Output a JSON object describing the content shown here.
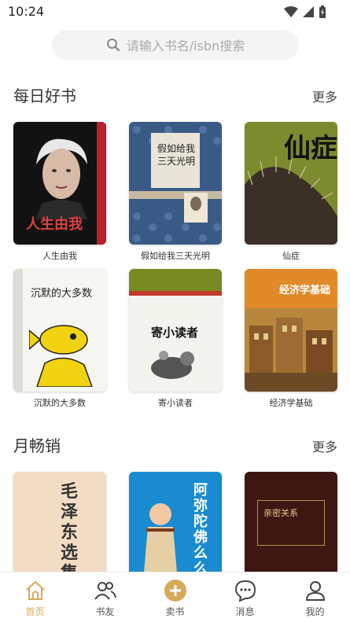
{
  "status": {
    "time": "10:24"
  },
  "search": {
    "placeholder": "请输入书名/isbn搜索"
  },
  "sections": [
    {
      "title": "每日好书",
      "more": "更多",
      "books": [
        {
          "title": "人生由我",
          "cover_text": "人生由我"
        },
        {
          "title": "假如给我三天光明",
          "cover_text": "假如给我三天光明"
        },
        {
          "title": "仙症",
          "cover_text": "仙症"
        },
        {
          "title": "沉默的大多数",
          "cover_text": "沉默的大多数"
        },
        {
          "title": "寄小读者",
          "cover_text": "寄小读者"
        },
        {
          "title": "经济学基础",
          "cover_text": "经济学基础"
        }
      ]
    },
    {
      "title": "月畅销",
      "more": "更多",
      "books": [
        {
          "cover_text": "毛泽东选集"
        },
        {
          "cover_text": "阿弥陀佛么么哒"
        },
        {
          "cover_text": "亲密关系"
        }
      ]
    }
  ],
  "tabbar": {
    "items": [
      {
        "label": "首页",
        "icon": "home-icon",
        "active": true
      },
      {
        "label": "书友",
        "icon": "friends-icon",
        "active": false
      },
      {
        "label": "卖书",
        "icon": "plus-circle-icon",
        "active": false
      },
      {
        "label": "消息",
        "icon": "message-icon",
        "active": false
      },
      {
        "label": "我的",
        "icon": "user-icon",
        "active": false
      }
    ]
  },
  "colors": {
    "accent": "#d7aa5a",
    "text": "#333333",
    "search_bg": "#f4f4f4"
  }
}
